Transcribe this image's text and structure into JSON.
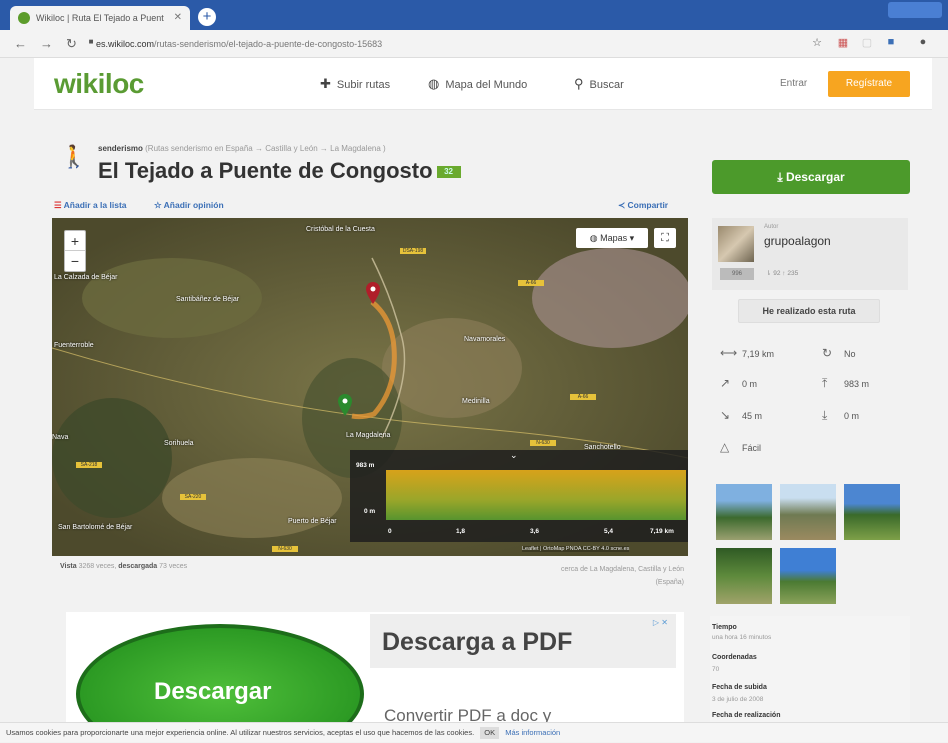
{
  "browser": {
    "tab_title": "Wikiloc | Ruta El Tejado a Puent",
    "url_domain": "es.wikiloc.com",
    "url_path": "/rutas-senderismo/el-tejado-a-puente-de-congosto-15683"
  },
  "header": {
    "logo": "wikiloc",
    "subir": "Subir rutas",
    "mapa": "Mapa del Mundo",
    "buscar": "Buscar",
    "entrar": "Entrar",
    "registrate": "Regístrate"
  },
  "trail": {
    "activity": "senderismo",
    "breadcrumb": "(Rutas senderismo en España → Castilla y León → La Magdalena )",
    "title": "El Tejado a Puente de Congosto",
    "badge": "32",
    "add_list": "Añadir a la lista",
    "add_opinion": "Añadir opinión",
    "share": "Compartir"
  },
  "map": {
    "mapas": "Mapas",
    "places": [
      "Cristóbal de la Cuesta",
      "La Calzada de Béjar",
      "Santibáñez de Béjar",
      "Navamorales",
      "Sorihuela",
      "Nava",
      "La Magdalena",
      "Sanchotello",
      "San Bartolomé de Béjar",
      "Puerto de Béjar",
      "Fuenterroble",
      "Medinilla"
    ],
    "elev_max": "983 m",
    "elev_min": "0 m",
    "elev_ticks": [
      "0",
      "1,8",
      "3,6",
      "5,4",
      "7,19 km"
    ],
    "attribution": "Leaflet | OrtoMap PNOA CC-BY 4.0 scne.es"
  },
  "stats": {
    "vista_label": "Vista",
    "vista_value": "3268 veces,",
    "descargada_label": "descargada",
    "descargada_value": "73 veces",
    "location_line1": "cerca de La Magdalena, Castilla y León",
    "location_line2": "(España)"
  },
  "ad": {
    "button": "Descargar",
    "title": "Descarga a PDF",
    "subtitle": "Convertir PDF a doc y",
    "adchoice": "▷ ✕"
  },
  "sidebar": {
    "download": "Descargar",
    "author_label": "Autor",
    "author_name": "grupoalagon",
    "author_badge": "996",
    "author_stats": "⇂ 92   ↑ 235",
    "done": "He realizado esta ruta",
    "distance": "7,19 km",
    "loop": "No",
    "gain": "0 m",
    "max_alt": "983 m",
    "loss": "45 m",
    "min_alt": "0 m",
    "difficulty": "Fácil",
    "info": [
      {
        "k": "Tiempo",
        "v": "una hora 16 minutos"
      },
      {
        "k": "Coordenadas",
        "v": "70"
      },
      {
        "k": "Fecha de subida",
        "v": "3 de julio de 2008"
      },
      {
        "k": "Fecha de realización",
        "v": ""
      }
    ]
  },
  "cookie": {
    "text": "Usamos cookies para proporcionarte una mejor experiencia online. Al utilizar nuestros servicios, aceptas el uso que hacemos de las cookies.",
    "ok": "OK",
    "more": "Más información"
  }
}
